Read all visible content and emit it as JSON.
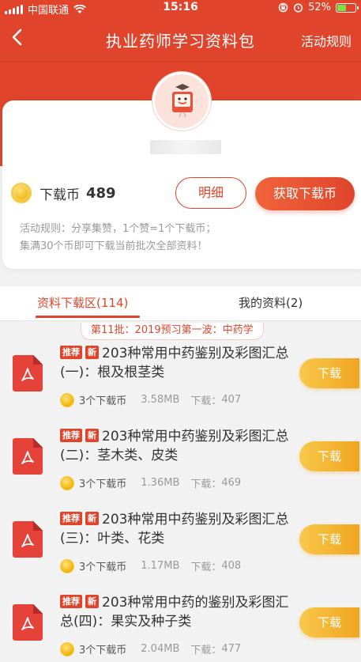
{
  "status_bar": {
    "carrier": "中国联通",
    "time": "15:16",
    "battery": "52%",
    "battery_level": 0.52
  },
  "nav": {
    "title": "执业药师学习资料包",
    "rules_link": "活动规则"
  },
  "profile": {
    "coin_label": "下载币",
    "coin_count": "489",
    "detail_button": "明细",
    "get_coins_button": "获取下载币",
    "rules_line1": "活动规则：分享集赞，1个赞=1个下载币；",
    "rules_line2": "集满30个币即可下载当前批次全部资料！"
  },
  "tabs": [
    {
      "label": "资料下载区(114)",
      "active": true
    },
    {
      "label": "我的资料(2)",
      "active": false
    }
  ],
  "batch_label": "第11批：2019预习第一波：中药学",
  "colors": {
    "primary": "#e0452c",
    "download_button": "#f0a521"
  },
  "tags": {
    "recommend": "推荐",
    "new": "新"
  },
  "download_label": "下载",
  "downloads_prefix": "下载：",
  "items": [
    {
      "title": "203种常用中药鉴别及彩图汇总(一)：根及根茎类",
      "cost": "3个下载币",
      "size": "3.58MB",
      "downloads": "407"
    },
    {
      "title": "203种常用中药鉴别及彩图汇总(二)：茎木类、皮类",
      "cost": "3个下载币",
      "size": "1.36MB",
      "downloads": "469"
    },
    {
      "title": "203种常用中药鉴别及彩图汇总(三)：叶类、花类",
      "cost": "3个下载币",
      "size": "1.17MB",
      "downloads": "408"
    },
    {
      "title": "203种常用中药的鉴别及彩图汇总(四)：果实及种子类",
      "cost": "3个下载币",
      "size": "2.04MB",
      "downloads": "477"
    }
  ]
}
